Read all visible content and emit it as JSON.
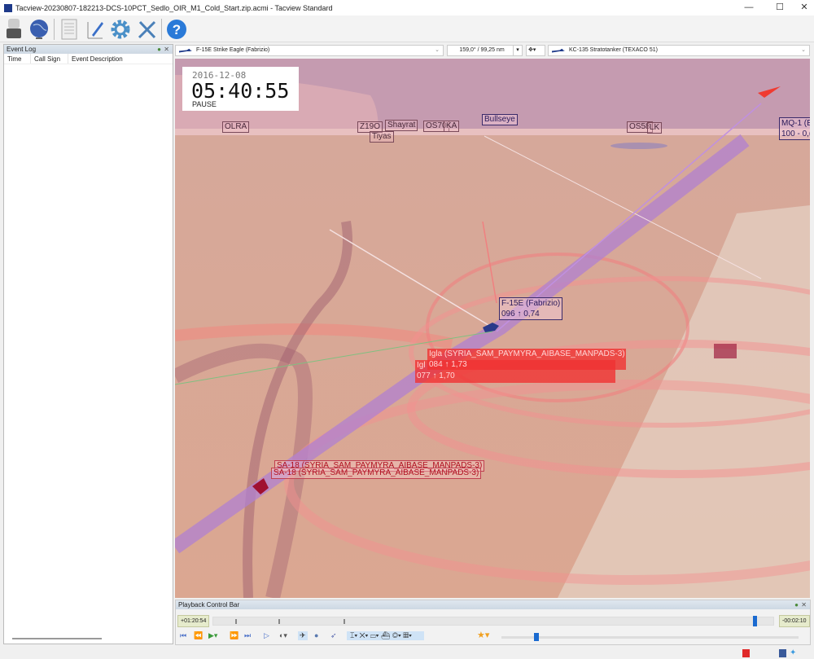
{
  "window": {
    "title": "Tacview-20230807-182213-DCS-10PCT_Sedlo_OIR_M1_Cold_Start.zip.acmi - Tacview Standard",
    "minimize": "—",
    "maximize": "☐",
    "close": "✕"
  },
  "toolbar": {
    "icons": [
      "usb-drive-icon",
      "globe-icon",
      "document-icon",
      "notepad-pen-icon",
      "gear-icon",
      "tools-icon",
      "help-icon"
    ]
  },
  "event_log": {
    "title": "Event Log",
    "columns": [
      "Time",
      "Call Sign",
      "Event Description"
    ],
    "close": "✕"
  },
  "view_bar": {
    "primary_object": "F-15E Strike Eagle (Fabrizio)",
    "bearing_range": "159,0° / 99,25 nm",
    "secondary_object": "KC-135 Stratotanker (TEXACO 51)"
  },
  "clock": {
    "date": "2016-12-08",
    "time": "05:40:55",
    "state": "PAUSE"
  },
  "map_labels": {
    "olra": "OLRA",
    "z19o": "Z19O",
    "tiyas": "Tiyas",
    "shayrat": "Shayrat",
    "os70": "OS70",
    "ka": "KA",
    "bullseye": "Bullseye",
    "os58": "OS58",
    "lk": "LK",
    "mq1_name": "MQ-1 (E",
    "mq1_data": "100 - 0,("
  },
  "objects": {
    "f15": {
      "name": "F-15E (Fabrizio)",
      "data": "096 ↑ 0,74"
    },
    "igla1": {
      "name": "Igla (SYRIA_SAM_PAYMYRA_AIBASE_MANPADS-3)",
      "data": "084 ↑ 1,73"
    },
    "igla2": {
      "name": "Igl",
      "data": "077 ↑ 1,70"
    },
    "sa18a": "SA-18 (SYRIA_SAM_PAYMYRA_AIBASE_MANPADS-3)",
    "sa18b": "SA-18 (SYRIA_SAM_PAYMYRA_AIBASE_MANPADS-3)"
  },
  "playback": {
    "title": "Playback Control Bar",
    "elapsed": "+01:20:54",
    "remaining": "-00:02:10",
    "progress": 0.968,
    "speed_level": 0.11,
    "close": "✕"
  },
  "colors": {
    "accent": "#3a6fc8",
    "sky": "#c59bb0",
    "threat": "#f03a3a"
  }
}
